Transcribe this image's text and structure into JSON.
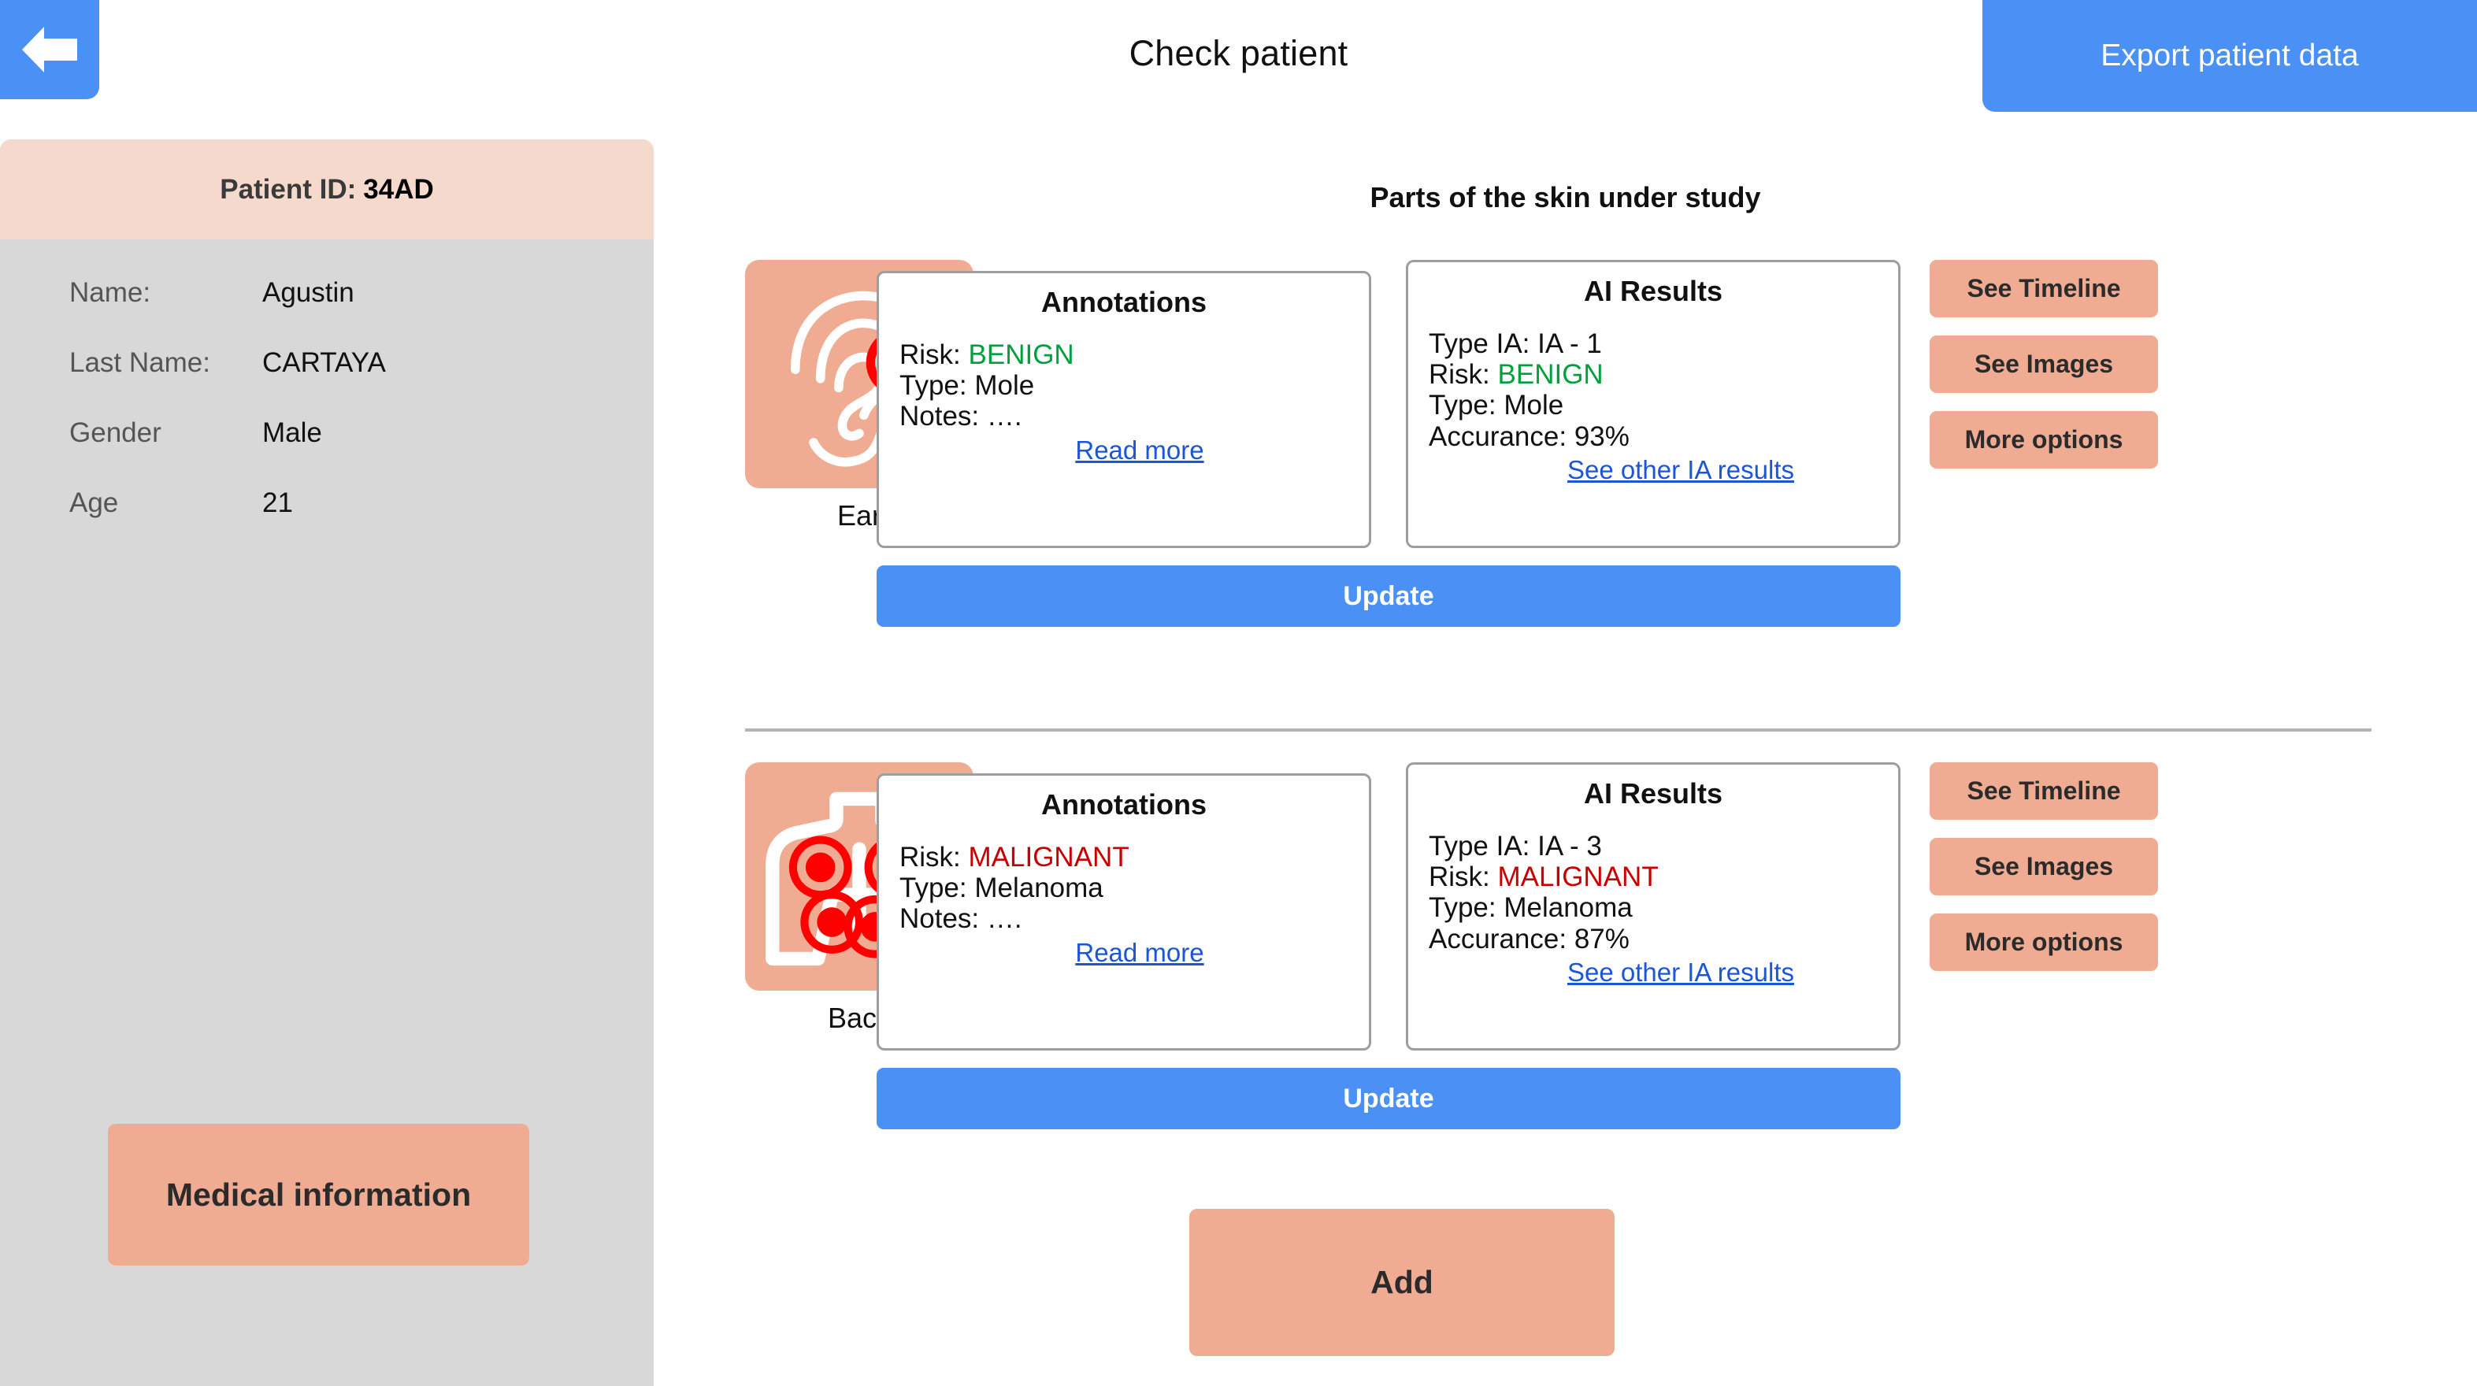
{
  "header": {
    "title": "Check patient",
    "back_icon": "left-arrow-icon",
    "export_label": "Export patient data"
  },
  "sidebar": {
    "patient_id_label": "Patient ID:",
    "patient_id_value": "34AD",
    "details": [
      {
        "label": "Name:",
        "value": "Agustin"
      },
      {
        "label": "Last Name:",
        "value": "CARTAYA"
      },
      {
        "label": "Gender",
        "value": "Male"
      },
      {
        "label": "Age",
        "value": "21"
      }
    ],
    "medical_info_label": "Medical information"
  },
  "main": {
    "section_title": "Parts of the skin under study",
    "add_label": "Add",
    "rows": [
      {
        "thumb_icon": "ear-icon",
        "thumb_label": "Ear",
        "marker_count": 1,
        "annotations": {
          "title": "Annotations",
          "risk_label": "Risk:",
          "risk_value": "BENIGN",
          "risk_level": "benign",
          "type_label": "Type:",
          "type_value": "Mole",
          "notes_label": "Notes:",
          "notes_value": "….",
          "link": "Read more"
        },
        "ai": {
          "title": "AI Results",
          "type_ia_label": "Type IA:",
          "type_ia_value": "IA - 1",
          "risk_label": "Risk:",
          "risk_value": "BENIGN",
          "risk_level": "benign",
          "type_label": "Type:",
          "type_value": "Mole",
          "accuracy_label": "Accurance:",
          "accuracy_value": "93%",
          "link": "See other IA results"
        },
        "actions": [
          "See Timeline",
          "See Images",
          "More options"
        ],
        "update_label": "Update"
      },
      {
        "thumb_icon": "torso-back-icon",
        "thumb_label": "Back",
        "marker_count": 4,
        "annotations": {
          "title": "Annotations",
          "risk_label": "Risk:",
          "risk_value": "MALIGNANT",
          "risk_level": "malignant",
          "type_label": "Type:",
          "type_value": "Melanoma",
          "notes_label": "Notes:",
          "notes_value": "….",
          "link": "Read more"
        },
        "ai": {
          "title": "AI Results",
          "type_ia_label": "Type IA:",
          "type_ia_value": "IA - 3",
          "risk_label": "Risk:",
          "risk_value": "MALIGNANT",
          "risk_level": "malignant",
          "type_label": "Type:",
          "type_value": "Melanoma",
          "accuracy_label": "Accurance:",
          "accuracy_value": "87%",
          "link": "See other IA results"
        },
        "actions": [
          "See Timeline",
          "See Images",
          "More options"
        ],
        "update_label": "Update"
      }
    ]
  },
  "colors": {
    "accent_blue": "#4a90f5",
    "salmon": "#efac93",
    "salmon_light": "#f6d9cd",
    "sidebar_gray": "#d8d8d8",
    "benign_green": "#00a03c",
    "malignant_red": "#c80000",
    "link_blue": "#1a56d6",
    "marker_red": "#ff0000"
  }
}
